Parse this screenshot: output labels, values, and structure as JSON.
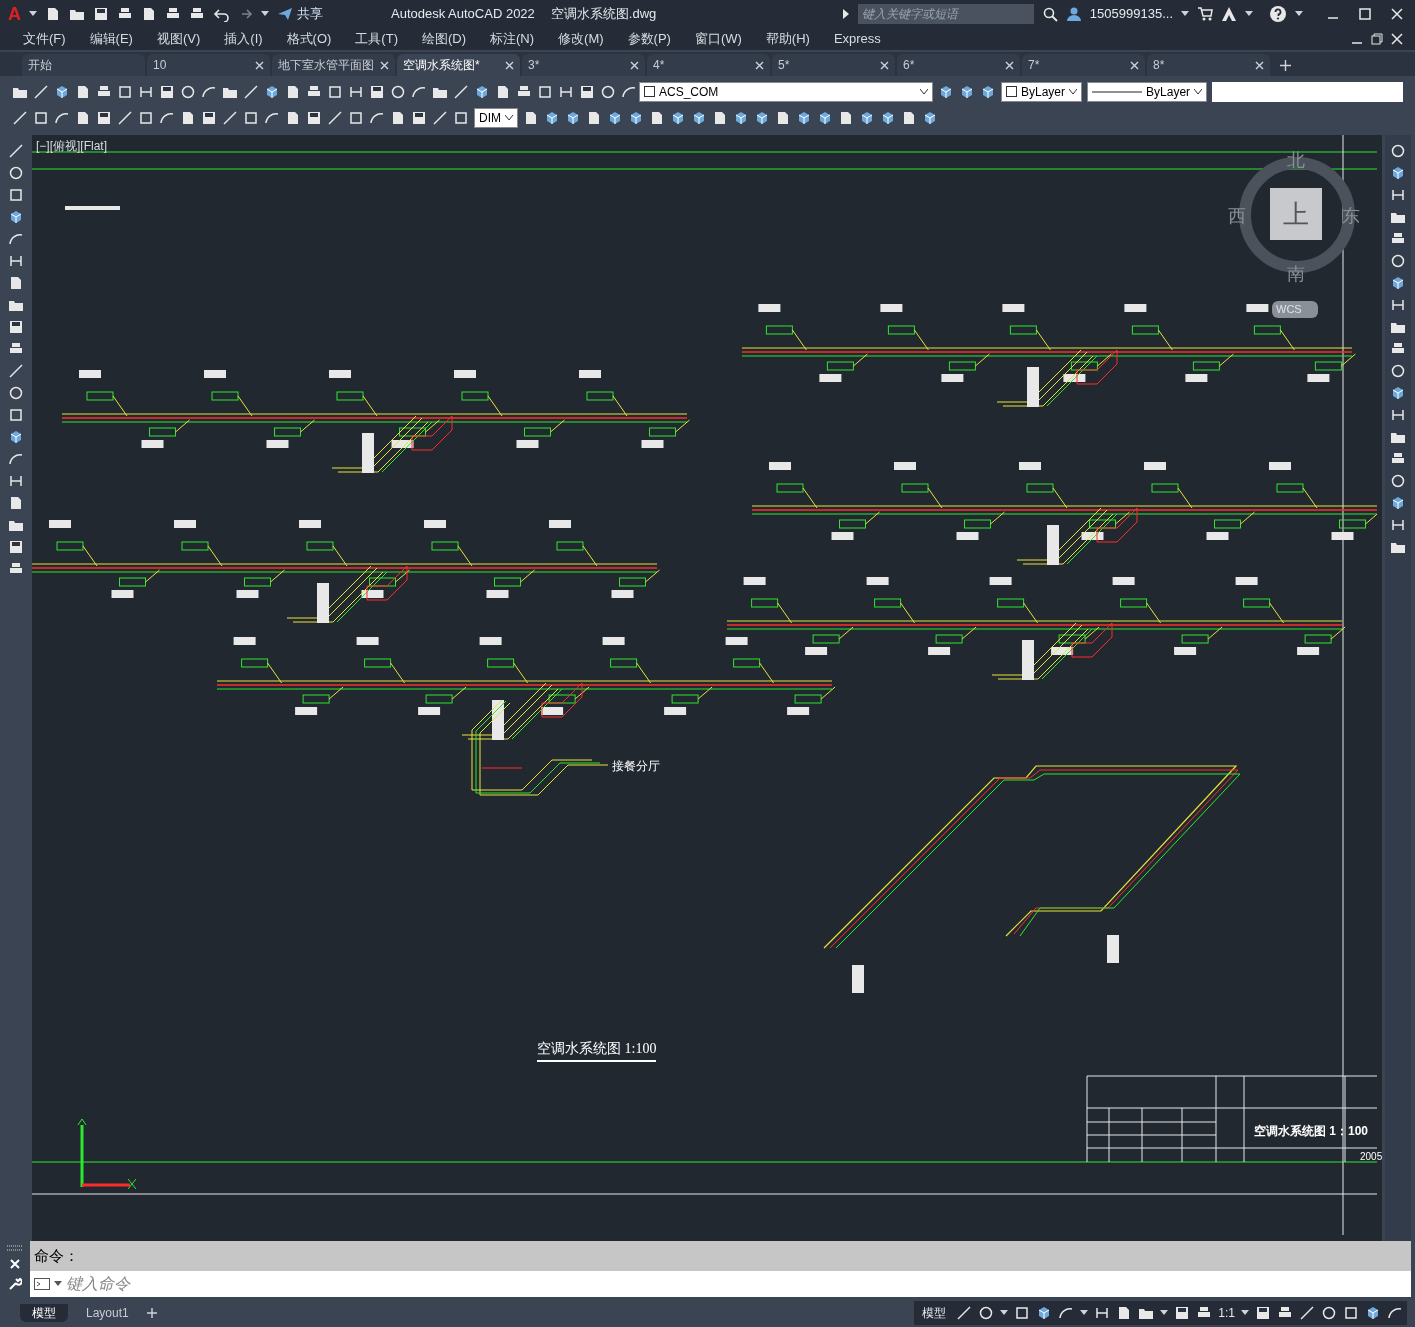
{
  "app": {
    "logo": "A",
    "share": "共享",
    "title": "Autodesk AutoCAD 2022",
    "file": "空调水系统图.dwg",
    "search": {
      "placeholder": "键入关键字或短语"
    },
    "user": "1505999135..."
  },
  "menu": [
    "文件(F)",
    "编辑(E)",
    "视图(V)",
    "插入(I)",
    "格式(O)",
    "工具(T)",
    "绘图(D)",
    "标注(N)",
    "修改(M)",
    "参数(P)",
    "窗口(W)",
    "帮助(H)",
    "Express"
  ],
  "tabs": [
    {
      "label": "开始",
      "selected": false,
      "closable": false
    },
    {
      "label": "10",
      "selected": false,
      "closable": true
    },
    {
      "label": "地下室水管平面图",
      "selected": false,
      "closable": true
    },
    {
      "label": "空调水系统图*",
      "selected": true,
      "closable": true
    },
    {
      "label": "3*",
      "selected": false,
      "closable": true
    },
    {
      "label": "4*",
      "selected": false,
      "closable": true
    },
    {
      "label": "5*",
      "selected": false,
      "closable": true
    },
    {
      "label": "6*",
      "selected": false,
      "closable": true
    },
    {
      "label": "7*",
      "selected": false,
      "closable": true
    },
    {
      "label": "8*",
      "selected": false,
      "closable": true
    }
  ],
  "toolbar": {
    "layer": "ACS_COM",
    "object_color": "ByLayer",
    "linetype": "ByLayer",
    "dimstyle": "DIM"
  },
  "viewport": {
    "label": "[−][俯视][Flat]",
    "viewcube": {
      "top": "上",
      "north": "北",
      "south": "南",
      "east": "东",
      "west": "西",
      "ucs": "WCS"
    }
  },
  "drawing": {
    "title": "空调水系统图 1:100",
    "branch_label": "接餐分厅",
    "title_block": {
      "name": "空调水系统图 1：100",
      "year": "2005"
    }
  },
  "command": {
    "history": "命令：",
    "placeholder": "键入命令"
  },
  "layout_tabs": [
    {
      "label": "模型",
      "selected": true
    },
    {
      "label": "Layout1",
      "selected": false
    }
  ],
  "status": {
    "space": "模型",
    "scale": "1:1"
  }
}
